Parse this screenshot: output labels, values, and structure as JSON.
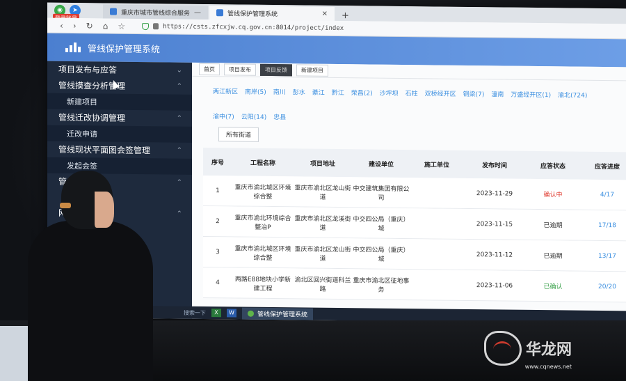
{
  "browser": {
    "login_badge": "登录账号",
    "tabs": [
      {
        "label": "重庆市城市管线综合服务",
        "close": "—"
      },
      {
        "label": "管线保护管理系统",
        "close": "✕"
      }
    ],
    "new_tab": "+",
    "url": "https://csts.zfcxjw.cq.gov.cn:8014/project/index"
  },
  "app": {
    "title": "管线保护管理系统"
  },
  "sidebar": {
    "items": [
      {
        "label": "项目发布与应答",
        "sub": null
      },
      {
        "label": "管线摸查分析管理",
        "sub": "新建项目"
      },
      {
        "label": "管线迁改协调管理",
        "sub": "迁改申请"
      },
      {
        "label": "管线现状平面图会签管理",
        "sub": "发起会签"
      },
      {
        "label": "管",
        "sub": null
      },
      {
        "label": "网",
        "sub": null
      }
    ]
  },
  "subtabs": [
    "首页",
    "项目发布",
    "项目反馈",
    "新建项目"
  ],
  "districts": [
    "两江新区",
    "南岸(5)",
    "南川",
    "彭水",
    "綦江",
    "黔江",
    "荣昌(2)",
    "沙坪坝",
    "石柱",
    "双桥经开区",
    "铜梁(7)",
    "潼南",
    "万盛经开区(1)",
    "渝北(724)",
    "渝中(7)",
    "云阳(14)",
    "忠县"
  ],
  "street_button": "所有街道",
  "table": {
    "headers": [
      "序号",
      "工程名称",
      "项目地址",
      "建设单位",
      "施工单位",
      "发布时间",
      "应答状态",
      "应答进度"
    ],
    "rows": [
      {
        "no": "1",
        "name": "重庆市渝北城区环境综合整",
        "addr": "重庆市渝北区龙山街道",
        "unit": "中交建筑集团有限公司",
        "builder": "",
        "date": "2023-11-29",
        "status": "确认中",
        "progress": "4/17"
      },
      {
        "no": "2",
        "name": "重庆市渝北环境综合整治P",
        "addr": "重庆市渝北区龙溪街道",
        "unit": "中交四公局（重庆）城",
        "builder": "",
        "date": "2023-11-15",
        "status": "已逾期",
        "progress": "17/18"
      },
      {
        "no": "3",
        "name": "重庆市渝北城区环境综合整",
        "addr": "重庆市渝北区龙山街道",
        "unit": "中交四公局（重庆）城",
        "builder": "",
        "date": "2023-11-12",
        "status": "已逾期",
        "progress": "13/17"
      },
      {
        "no": "4",
        "name": "两路E88地块小学新建工程",
        "addr": "渝北区回兴街道科兰路",
        "unit": "重庆市渝北区征地事务",
        "builder": "",
        "date": "2023-11-06",
        "status": "已确认",
        "progress": "20/20"
      }
    ]
  },
  "taskbar": {
    "search": "搜索一下",
    "apps": [
      "X",
      "W"
    ],
    "active": "管线保护管理系统"
  },
  "watermark": {
    "text": "华龙网",
    "url": "www.cqnews.net"
  }
}
